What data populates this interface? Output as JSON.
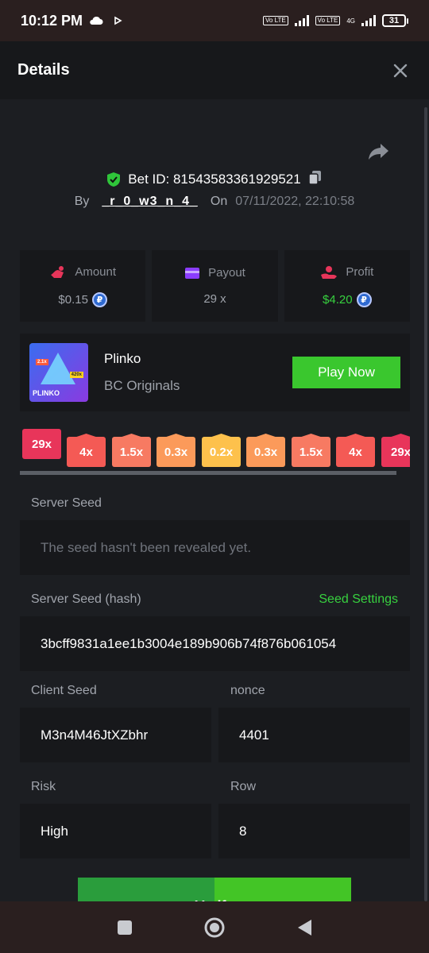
{
  "status_bar": {
    "time": "10:12 PM",
    "battery": "31",
    "net_tag_1": "Vo LTE",
    "net_tag_2": "Vo LTE",
    "net_4g": "4G"
  },
  "header": {
    "title": "Details"
  },
  "bet": {
    "id_label": "Bet ID: 81543583361929521",
    "by_label": "By",
    "user": "_r_0_w3_n_4_",
    "on_label": "On",
    "date": "07/11/2022, 22:10:58"
  },
  "stats": [
    {
      "label": "Amount",
      "value": "$0.15",
      "color": "#e7355a"
    },
    {
      "label": "Payout",
      "value": "29 x",
      "color": "#8b3dff"
    },
    {
      "label": "Profit",
      "value": "$4.20",
      "color": "#e7355a"
    }
  ],
  "coin_symbol": "₽",
  "game": {
    "name": "Plinko",
    "provider": "BC Originals",
    "thumb_label": "PLINKO",
    "thumb_tag_1": "2.1x",
    "thumb_tag_2": "420x",
    "play_label": "Play Now"
  },
  "multipliers": [
    {
      "label": "29x",
      "color": "#e8355a"
    },
    {
      "label": "4x",
      "color": "#f45a55"
    },
    {
      "label": "1.5x",
      "color": "#f77a62"
    },
    {
      "label": "0.3x",
      "color": "#fb9a5a"
    },
    {
      "label": "0.2x",
      "color": "#fdc14c"
    },
    {
      "label": "0.3x",
      "color": "#fb9a5a"
    },
    {
      "label": "1.5x",
      "color": "#f77a62"
    },
    {
      "label": "4x",
      "color": "#f45a55"
    },
    {
      "label": "29x",
      "color": "#e8355a"
    }
  ],
  "fields": {
    "server_seed_label": "Server Seed",
    "server_seed_placeholder": "The seed hasn't been revealed yet.",
    "server_hash_label": "Server Seed (hash)",
    "seed_settings_link": "Seed Settings",
    "server_hash_value": "3bcff9831a1ee1b3004e189b906b74f876b061054",
    "client_seed_label": "Client Seed",
    "client_seed_value": "M3n4M46JtXZbhr",
    "nonce_label": "nonce",
    "nonce_value": "4401",
    "risk_label": "Risk",
    "risk_value": "High",
    "row_label": "Row",
    "row_value": "8"
  },
  "verify_label": "Verify"
}
